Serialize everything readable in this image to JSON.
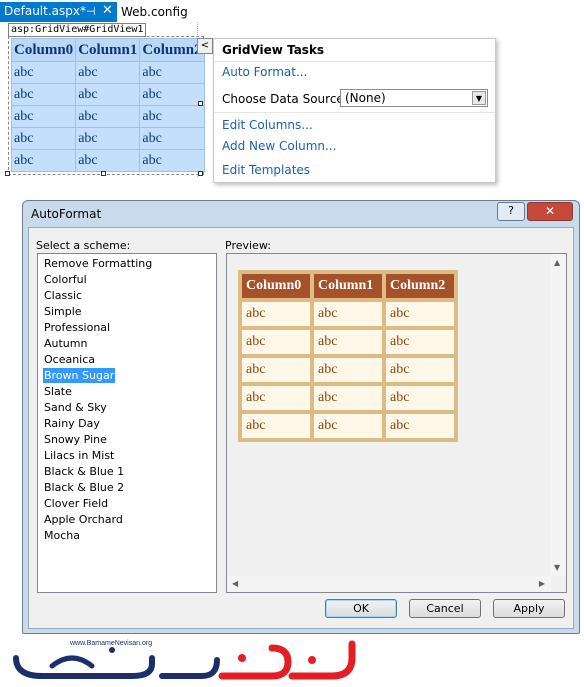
{
  "editor": {
    "tabs": [
      {
        "label": "Default.aspx*",
        "active": true
      },
      {
        "label": "Web.config",
        "active": false
      }
    ],
    "pin_glyph": "⊣",
    "close_glyph": "✕",
    "control_label": "asp:GridView#GridView1",
    "smart_tag_glyph": "<",
    "grid": {
      "columns": [
        "Column0",
        "Column1",
        "Column2"
      ],
      "rows": [
        [
          "abc",
          "abc",
          "abc"
        ],
        [
          "abc",
          "abc",
          "abc"
        ],
        [
          "abc",
          "abc",
          "abc"
        ],
        [
          "abc",
          "abc",
          "abc"
        ],
        [
          "abc",
          "abc",
          "abc"
        ]
      ]
    }
  },
  "tasks_panel": {
    "title": "GridView Tasks",
    "auto_format": "Auto Format...",
    "data_source_label": "Choose Data Source:",
    "data_source_value": "(None)",
    "edit_columns": "Edit Columns...",
    "add_column": "Add New Column...",
    "edit_templates": "Edit Templates"
  },
  "dialog": {
    "title": "AutoFormat",
    "help_glyph": "?",
    "close_glyph": "✕",
    "scheme_label": "Select a scheme:",
    "preview_label": "Preview:",
    "schemes": [
      "Remove Formatting",
      "Colorful",
      "Classic",
      "Simple",
      "Professional",
      "Autumn",
      "Oceanica",
      "Brown Sugar",
      "Slate",
      "Sand & Sky",
      "Rainy Day",
      "Snowy Pine",
      "Lilacs in Mist",
      "Black & Blue 1",
      "Black & Blue 2",
      "Clover Field",
      "Apple Orchard",
      "Mocha"
    ],
    "selected_scheme": "Brown Sugar",
    "preview": {
      "columns": [
        "Column0",
        "Column1",
        "Column2"
      ],
      "rows": [
        [
          "abc",
          "abc",
          "abc"
        ],
        [
          "abc",
          "abc",
          "abc"
        ],
        [
          "abc",
          "abc",
          "abc"
        ],
        [
          "abc",
          "abc",
          "abc"
        ],
        [
          "abc",
          "abc",
          "abc"
        ]
      ]
    },
    "buttons": {
      "ok": "OK",
      "cancel": "Cancel",
      "apply": "Apply"
    }
  },
  "watermark": {
    "url": "www.BamameNevisan.org",
    "brand_text": "برنامه نویسان"
  },
  "colors": {
    "accent": "#007acc",
    "link": "#1a5fb4",
    "selection": "#3399ff",
    "brown_header": "#a55129",
    "brown_border": "#deba84",
    "brown_cell": "#fff7e7",
    "brown_text": "#8c4510",
    "grid_blue": "#c4dffb",
    "logo_red": "#e31e24",
    "logo_blue": "#1d2f6b"
  }
}
